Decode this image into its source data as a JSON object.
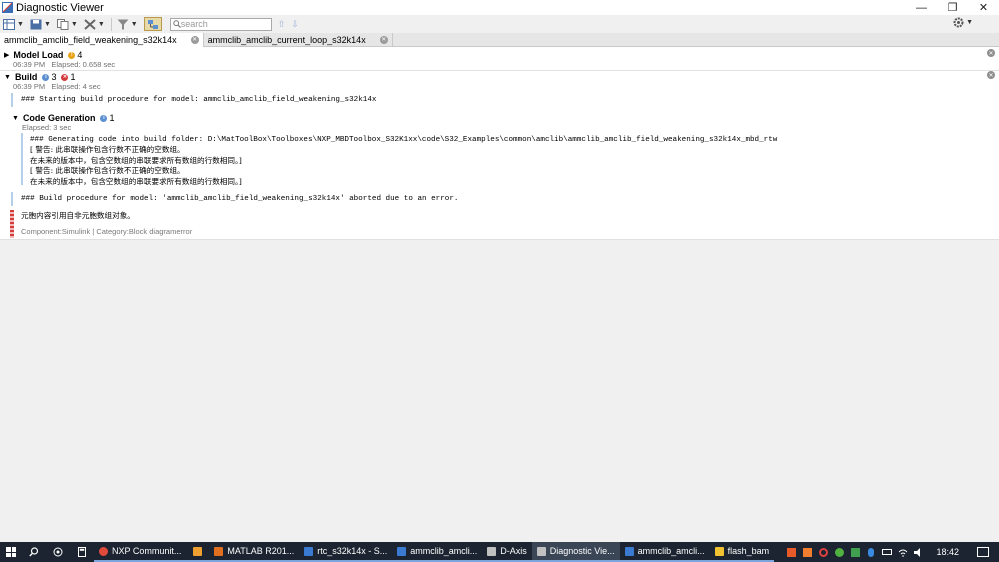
{
  "window": {
    "title": "Diagnostic Viewer",
    "controls": {
      "minimize": "—",
      "restore": "❐",
      "close": "✕"
    }
  },
  "toolbar": {
    "search_placeholder": "search",
    "prev_arrow": "⇧",
    "next_arrow": "⇩"
  },
  "tabs": [
    {
      "label": "ammclib_amclib_field_weakening_s32k14x"
    },
    {
      "label": "ammclib_amclib_current_loop_s32k14x"
    }
  ],
  "sections": {
    "model_load": {
      "title": "Model Load",
      "warn_count": "4",
      "time": "06:39 PM",
      "elapsed": "Elapsed: 0.658 sec"
    },
    "build": {
      "title": "Build",
      "info_count": "3",
      "err_count": "1",
      "time": "06:39 PM",
      "elapsed": "Elapsed: 4 sec",
      "start_msg": "### Starting build procedure for model: ammclib_amclib_field_weakening_s32k14x",
      "codegen": {
        "title": "Code Generation",
        "info_count": "1",
        "elapsed": "Elapsed: 3 sec",
        "line1": "### Generating code into build folder: D:\\MatToolBox\\Toolboxes\\NXP_MBDToolbox_S32K1xx\\code\\S32_Examples\\common\\amclib\\ammclib_amclib_field_weakening_s32k14x_mbd_rtw",
        "line2": "[ 警告: 此串联操作包含行数不正确的空数组。",
        "line3": "在未来的版本中，包含空数组的串联要求所有数组的行数相同。]",
        "line4": "[ 警告: 此串联操作包含行数不正确的空数组。",
        "line5": "在未来的版本中，包含空数组的串联要求所有数组的行数相同。]"
      },
      "abort_msg": "### Build procedure for model: 'ammclib_amclib_field_weakening_s32k14x' aborted due to an error.",
      "error_msg": "元胞内容引用自非元胞数组对象。",
      "component": "Component:Simulink | Category:Block diagramerror"
    }
  },
  "taskbar": {
    "apps": [
      {
        "label": "NXP Communit...",
        "color": "#e04a3a"
      },
      {
        "label": "",
        "color": "#f0a030"
      },
      {
        "label": "MATLAB R201...",
        "color": "#e07020"
      },
      {
        "label": "rtc_s32k14x - S...",
        "color": "#3a7ad0"
      },
      {
        "label": "ammclib_amcli...",
        "color": "#3a7ad0"
      },
      {
        "label": "D-Axis",
        "color": "#c0c0c0"
      },
      {
        "label": "Diagnostic Vie...",
        "color": "#c0c0c0"
      },
      {
        "label": "ammclib_amcli...",
        "color": "#3a7ad0"
      },
      {
        "label": "flash_bam",
        "color": "#f2c230"
      }
    ],
    "clock": "18:42"
  },
  "colors": {
    "info": "#5b8fd0",
    "warning": "#e8a317",
    "error": "#d43b3b"
  }
}
